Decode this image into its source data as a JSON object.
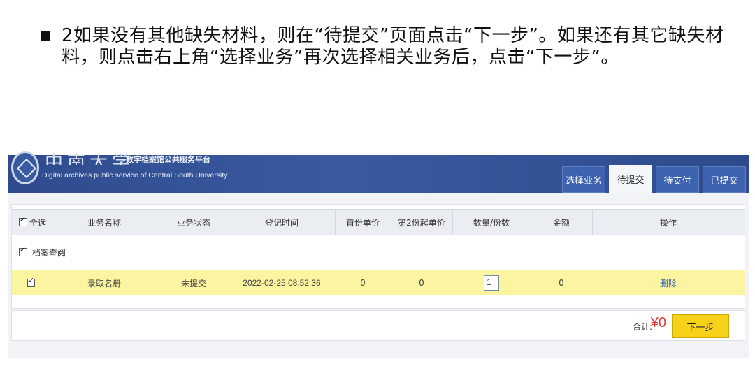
{
  "slide": {
    "text": "2如果没有其他缺失材料，则在“待提交”页面点击“下一步”。如果还有其它缺失材料，则点击右上角“选择业务”再次选择相关业务后，点击“下一步”。"
  },
  "app": {
    "script_logo": "中南大学",
    "platform_name": "数字档案馆公共服务平台",
    "platform_name_en": "Digital archives public service of Central South University"
  },
  "tabs": [
    "选择业务",
    "待提交",
    "待支付",
    "已提交"
  ],
  "active_tab": "待提交",
  "table": {
    "select_all": "全选",
    "columns": [
      "业务名称",
      "业务状态",
      "登记时间",
      "首份单价",
      "第2份起单价",
      "数量/份数",
      "金额",
      "操作"
    ],
    "group_label": "档案查阅",
    "rows": [
      {
        "name": "录取名册",
        "status": "未提交",
        "time": "2022-02-25 08:52:36",
        "first_price": "0",
        "second_price": "0",
        "quantity": "1",
        "amount": "0",
        "action": "删除"
      }
    ]
  },
  "footer": {
    "total_label": "合计:",
    "total_value": "¥0",
    "next_button": "下一步"
  },
  "colors": {
    "banner": "#2f4b8e",
    "row_highlight": "#fbf4a0",
    "next_button": "#f7d21a",
    "total": "#e53935"
  }
}
